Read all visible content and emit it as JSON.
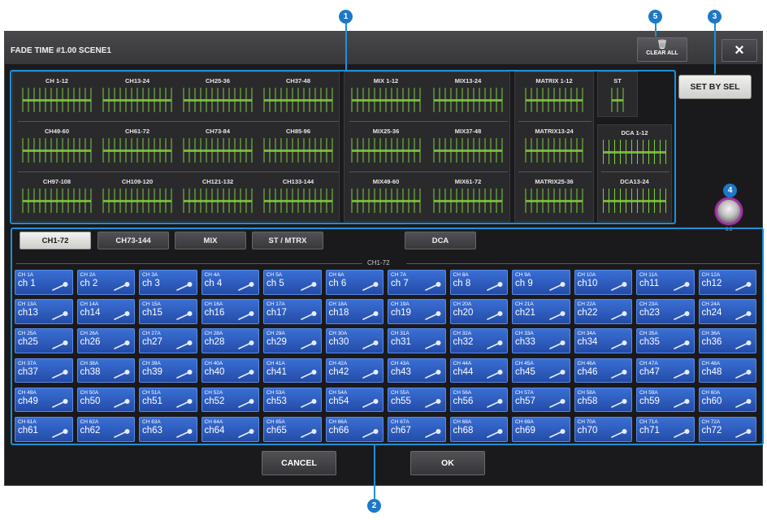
{
  "title": "FADE TIME #1.00 SCENE1",
  "clear_all": {
    "label": "CLEAR ALL"
  },
  "close_label": "×",
  "set_by_sel": "SET BY SEL",
  "knob_value": "0.0",
  "callouts": {
    "c1": "1",
    "c2": "2",
    "c3": "3",
    "c4": "4",
    "c5": "5"
  },
  "fader_groups": {
    "ch": [
      "CH 1-12",
      "CH13-24",
      "CH25-36",
      "CH37-48",
      "CH49-60",
      "CH61-72",
      "CH73-84",
      "CH85-96",
      "CH97-108",
      "CH109-120",
      "CH121-132",
      "CH133-144"
    ],
    "mix": [
      "MIX 1-12",
      "MIX13-24",
      "MIX25-36",
      "MIX37-48",
      "MIX49-60",
      "MIX61-72"
    ],
    "matrix": [
      "MATRIX 1-12",
      "MATRIX13-24",
      "MATRIX25-36"
    ],
    "st": "ST",
    "dca": [
      "DCA 1-12",
      "DCA13-24"
    ]
  },
  "tabs": [
    "CH1-72",
    "CH73-144",
    "MIX",
    "ST / MTRX",
    "DCA"
  ],
  "panel_title": "CH1-72",
  "bottom": {
    "cancel": "CANCEL",
    "ok": "OK"
  },
  "colors": {
    "accent": "#1e90d8",
    "channel_button": "#2f5fc4",
    "fader_green": "#7fce3c",
    "knob_ring": "#a03aa0"
  },
  "channels": [
    {
      "top": "CH 1A",
      "name": "ch 1"
    },
    {
      "top": "CH 2A",
      "name": "ch 2"
    },
    {
      "top": "CH 3A",
      "name": "ch 3"
    },
    {
      "top": "CH 4A",
      "name": "ch 4"
    },
    {
      "top": "CH 5A",
      "name": "ch 5"
    },
    {
      "top": "CH 6A",
      "name": "ch 6"
    },
    {
      "top": "CH 7A",
      "name": "ch 7"
    },
    {
      "top": "CH 8A",
      "name": "ch 8"
    },
    {
      "top": "CH 9A",
      "name": "ch 9"
    },
    {
      "top": "CH 10A",
      "name": "ch10"
    },
    {
      "top": "CH 11A",
      "name": "ch11"
    },
    {
      "top": "CH 12A",
      "name": "ch12"
    },
    {
      "top": "CH 13A",
      "name": "ch13"
    },
    {
      "top": "CH 14A",
      "name": "ch14"
    },
    {
      "top": "CH 15A",
      "name": "ch15"
    },
    {
      "top": "CH 16A",
      "name": "ch16"
    },
    {
      "top": "CH 17A",
      "name": "ch17"
    },
    {
      "top": "CH 18A",
      "name": "ch18"
    },
    {
      "top": "CH 19A",
      "name": "ch19"
    },
    {
      "top": "CH 20A",
      "name": "ch20"
    },
    {
      "top": "CH 21A",
      "name": "ch21"
    },
    {
      "top": "CH 22A",
      "name": "ch22"
    },
    {
      "top": "CH 23A",
      "name": "ch23"
    },
    {
      "top": "CH 24A",
      "name": "ch24"
    },
    {
      "top": "CH 25A",
      "name": "ch25"
    },
    {
      "top": "CH 26A",
      "name": "ch26"
    },
    {
      "top": "CH 27A",
      "name": "ch27"
    },
    {
      "top": "CH 28A",
      "name": "ch28"
    },
    {
      "top": "CH 29A",
      "name": "ch29"
    },
    {
      "top": "CH 30A",
      "name": "ch30"
    },
    {
      "top": "CH 31A",
      "name": "ch31"
    },
    {
      "top": "CH 32A",
      "name": "ch32"
    },
    {
      "top": "CH 33A",
      "name": "ch33"
    },
    {
      "top": "CH 34A",
      "name": "ch34"
    },
    {
      "top": "CH 35A",
      "name": "ch35"
    },
    {
      "top": "CH 36A",
      "name": "ch36"
    },
    {
      "top": "CH 37A",
      "name": "ch37"
    },
    {
      "top": "CH 38A",
      "name": "ch38"
    },
    {
      "top": "CH 39A",
      "name": "ch39"
    },
    {
      "top": "CH 40A",
      "name": "ch40"
    },
    {
      "top": "CH 41A",
      "name": "ch41"
    },
    {
      "top": "CH 42A",
      "name": "ch42"
    },
    {
      "top": "CH 43A",
      "name": "ch43"
    },
    {
      "top": "CH 44A",
      "name": "ch44"
    },
    {
      "top": "CH 45A",
      "name": "ch45"
    },
    {
      "top": "CH 46A",
      "name": "ch46"
    },
    {
      "top": "CH 47A",
      "name": "ch47"
    },
    {
      "top": "CH 48A",
      "name": "ch48"
    },
    {
      "top": "CH 49A",
      "name": "ch49"
    },
    {
      "top": "CH 50A",
      "name": "ch50"
    },
    {
      "top": "CH 51A",
      "name": "ch51"
    },
    {
      "top": "CH 52A",
      "name": "ch52"
    },
    {
      "top": "CH 53A",
      "name": "ch53"
    },
    {
      "top": "CH 54A",
      "name": "ch54"
    },
    {
      "top": "CH 55A",
      "name": "ch55"
    },
    {
      "top": "CH 56A",
      "name": "ch56"
    },
    {
      "top": "CH 57A",
      "name": "ch57"
    },
    {
      "top": "CH 58A",
      "name": "ch58"
    },
    {
      "top": "CH 59A",
      "name": "ch59"
    },
    {
      "top": "CH 60A",
      "name": "ch60"
    },
    {
      "top": "CH 61A",
      "name": "ch61"
    },
    {
      "top": "CH 62A",
      "name": "ch62"
    },
    {
      "top": "CH 63A",
      "name": "ch63"
    },
    {
      "top": "CH 64A",
      "name": "ch64"
    },
    {
      "top": "CH 65A",
      "name": "ch65"
    },
    {
      "top": "CH 66A",
      "name": "ch66"
    },
    {
      "top": "CH 67A",
      "name": "ch67"
    },
    {
      "top": "CH 68A",
      "name": "ch68"
    },
    {
      "top": "CH 69A",
      "name": "ch69"
    },
    {
      "top": "CH 70A",
      "name": "ch70"
    },
    {
      "top": "CH 71A",
      "name": "ch71"
    },
    {
      "top": "CH 72A",
      "name": "ch72"
    }
  ]
}
